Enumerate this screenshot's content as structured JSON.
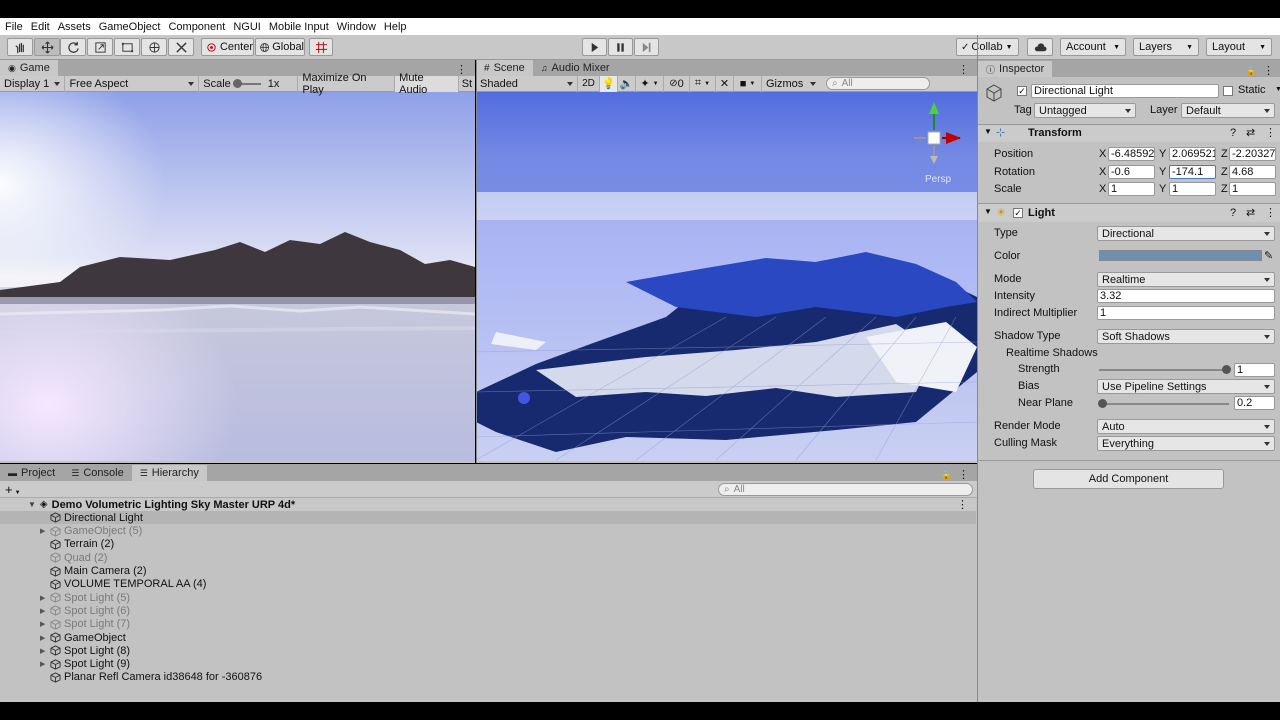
{
  "menu": [
    "File",
    "Edit",
    "Assets",
    "GameObject",
    "Component",
    "NGUI",
    "Mobile Input",
    "Window",
    "Help"
  ],
  "toolbar": {
    "center": "Center",
    "global": "Global",
    "collab": "Collab",
    "account": "Account",
    "layers": "Layers",
    "layout": "Layout"
  },
  "game": {
    "tab": "Game",
    "display": "Display 1",
    "aspect": "Free Aspect",
    "scale_label": "Scale",
    "scale_value": "1x",
    "maximize": "Maximize On Play",
    "mute": "Mute Audio",
    "stats": "St"
  },
  "scene": {
    "tab": "Scene",
    "audio_tab": "Audio Mixer",
    "shading": "Shaded",
    "mode2d": "2D",
    "hidden_count": "0",
    "gizmos": "Gizmos",
    "search_placeholder": "All",
    "persp": "Persp"
  },
  "bottom": {
    "project_tab": "Project",
    "console_tab": "Console",
    "hierarchy_tab": "Hierarchy",
    "search_placeholder": "All",
    "scene_name": "Demo Volumetric Lighting Sky Master URP 4d*",
    "items": [
      {
        "label": "Directional Light",
        "dim": false,
        "expand": false,
        "selected": true
      },
      {
        "label": "GameObject (5)",
        "dim": true,
        "expand": true,
        "selected": false
      },
      {
        "label": "Terrain (2)",
        "dim": false,
        "expand": false,
        "selected": false
      },
      {
        "label": "Quad (2)",
        "dim": true,
        "expand": false,
        "selected": false
      },
      {
        "label": "Main Camera (2)",
        "dim": false,
        "expand": false,
        "selected": false
      },
      {
        "label": "VOLUME TEMPORAL AA (4)",
        "dim": false,
        "expand": false,
        "selected": false
      },
      {
        "label": "Spot Light (5)",
        "dim": true,
        "expand": true,
        "selected": false
      },
      {
        "label": "Spot Light (6)",
        "dim": true,
        "expand": true,
        "selected": false
      },
      {
        "label": "Spot Light (7)",
        "dim": true,
        "expand": true,
        "selected": false
      },
      {
        "label": "GameObject",
        "dim": false,
        "expand": true,
        "selected": false
      },
      {
        "label": "Spot Light (8)",
        "dim": false,
        "expand": true,
        "selected": false
      },
      {
        "label": "Spot Light (9)",
        "dim": false,
        "expand": true,
        "selected": false
      },
      {
        "label": "Planar Refl Camera id38648 for -360876",
        "dim": false,
        "expand": false,
        "selected": false
      }
    ]
  },
  "inspector": {
    "tab": "Inspector",
    "name": "Directional Light",
    "static": "Static",
    "tag_label": "Tag",
    "tag": "Untagged",
    "layer_label": "Layer",
    "layer": "Default",
    "transform": {
      "title": "Transform",
      "position": "Position",
      "rotation": "Rotation",
      "scale": "Scale",
      "x": "X",
      "y": "Y",
      "z": "Z",
      "pos": [
        "-6.48592",
        "2.069521",
        "-2.20327"
      ],
      "rot": [
        "-0.6",
        "-174.1",
        "4.68"
      ],
      "scl": [
        "1",
        "1",
        "1"
      ]
    },
    "light": {
      "title": "Light",
      "type_label": "Type",
      "type": "Directional",
      "color_label": "Color",
      "color": "#6f8fb0",
      "mode_label": "Mode",
      "mode": "Realtime",
      "intensity_label": "Intensity",
      "intensity": "3.32",
      "indirect_label": "Indirect Multiplier",
      "indirect": "1",
      "shadow_type_label": "Shadow Type",
      "shadow_type": "Soft Shadows",
      "realtime_shadows": "Realtime Shadows",
      "strength_label": "Strength",
      "strength": "1",
      "strength_level": 1.0,
      "bias_label": "Bias",
      "bias": "Use Pipeline Settings",
      "near_plane_label": "Near Plane",
      "near_plane": "0.2",
      "near_plane_level": 0.0,
      "render_mode_label": "Render Mode",
      "render_mode": "Auto",
      "culling_label": "Culling Mask",
      "culling": "Everything"
    },
    "add_component": "Add Component"
  }
}
